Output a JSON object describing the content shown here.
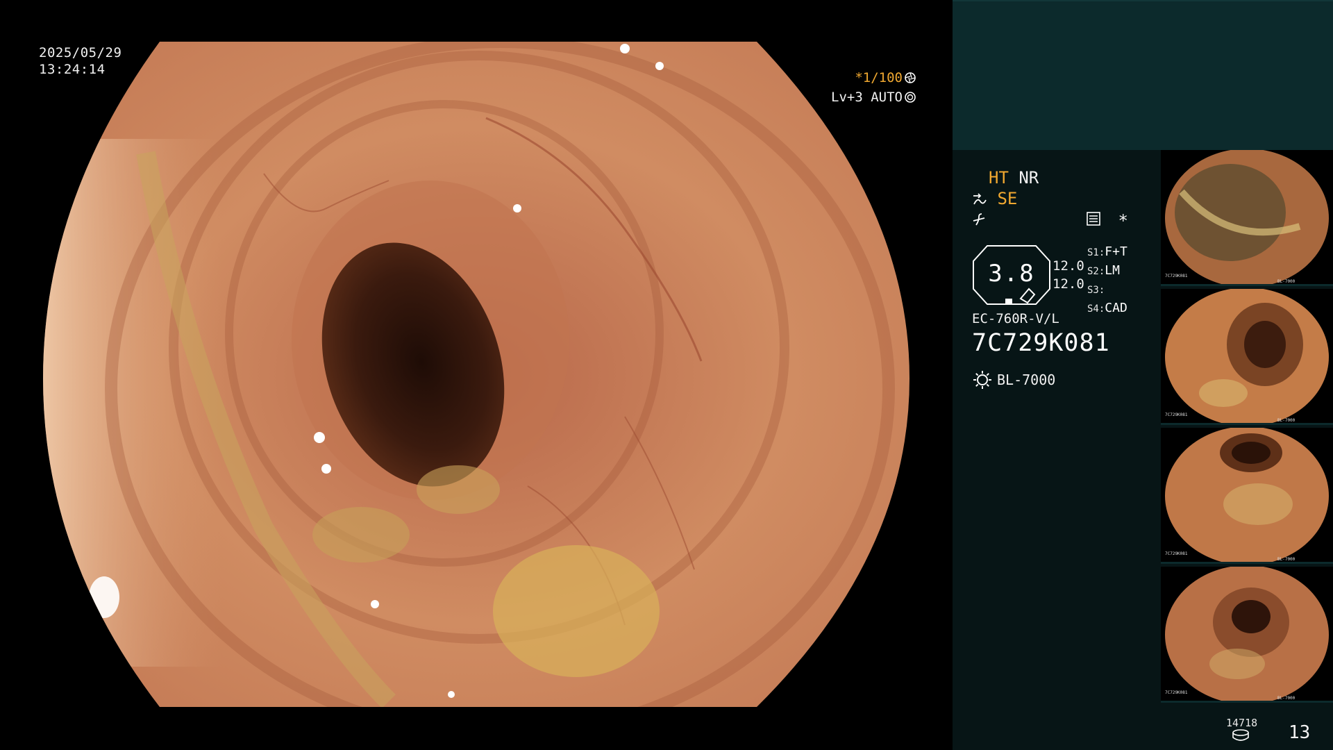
{
  "main_view": {
    "date": "2025/05/29",
    "time": "13:24:14",
    "shutter": "*1/100",
    "shutter_icon": "aperture-icon",
    "level": "Lv+3 AUTO",
    "level_icon": "iris-icon"
  },
  "panel": {
    "ht": "HT",
    "nr": "NR",
    "se": "SE",
    "se_icon": "structure-enhance-icon",
    "flat_icon": "color-mode-icon",
    "list_icon": "settings-list-icon",
    "asterisk": "*",
    "zoom_value": "3.8",
    "values": [
      "12.0",
      "12.0"
    ],
    "switches": [
      {
        "key": "S1:",
        "value": "F+T"
      },
      {
        "key": "S2:",
        "value": "LM"
      },
      {
        "key": "S3:",
        "value": ""
      },
      {
        "key": "S4:",
        "value": "CAD"
      }
    ],
    "scope_model": "EC-760R-V/L",
    "scope_serial": "7C729K081",
    "light_source": "BL-7000",
    "light_icon": "light-source-icon"
  },
  "thumbnails": [
    {
      "serial": "7C729K081",
      "source": "BL-7000"
    },
    {
      "serial": "7C729K081",
      "source": "BL-7000"
    },
    {
      "serial": "7C729K081",
      "source": "BL-7000"
    },
    {
      "serial": "7C729K081",
      "source": "BL-7000"
    }
  ],
  "footer": {
    "image_count": "14718",
    "storage_icon": "storage-disk-icon",
    "frame_number": "13"
  },
  "colors": {
    "accent_orange": "#f0a830",
    "panel_bg": "#071516",
    "panel_band": "#0c2a2c"
  }
}
